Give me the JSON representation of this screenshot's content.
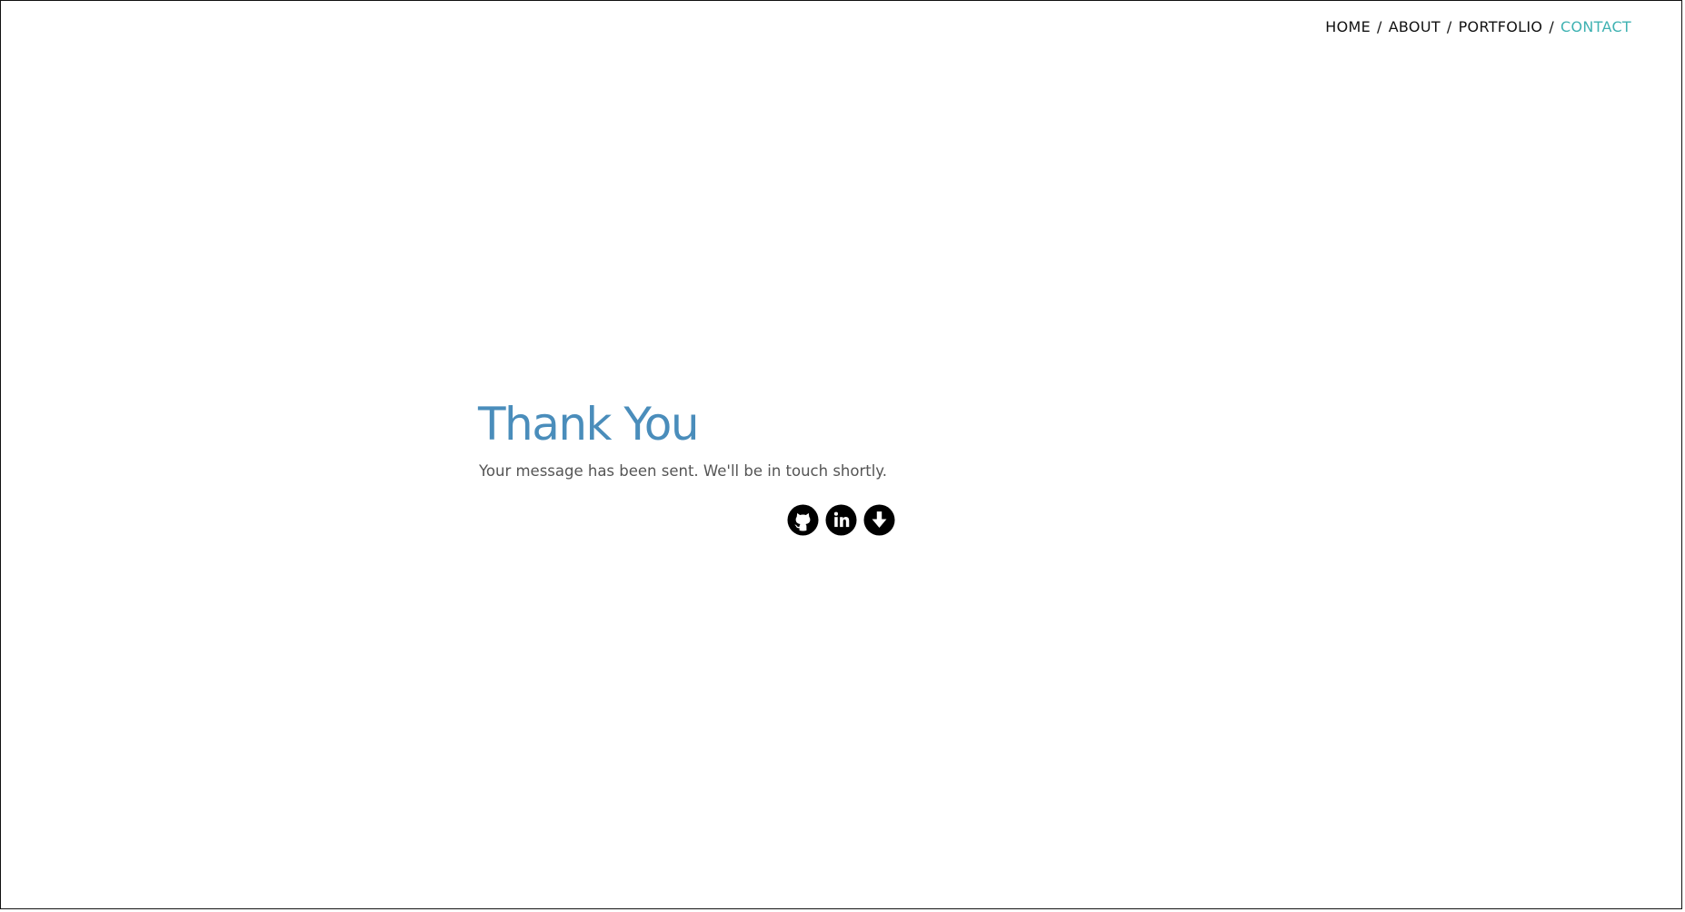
{
  "nav": {
    "items": [
      {
        "label": "HOME",
        "active": false
      },
      {
        "label": "ABOUT",
        "active": false
      },
      {
        "label": "PORTFOLIO",
        "active": false
      },
      {
        "label": "CONTACT",
        "active": true
      }
    ],
    "separator": "/",
    "active_color": "#3fb2b2"
  },
  "main": {
    "title": "Thank You",
    "message": "Your message has been sent. We'll be in touch shortly.",
    "title_color": "#4a8dbb"
  },
  "social": {
    "icons": [
      "github-icon",
      "linkedin-icon",
      "download-icon"
    ]
  }
}
